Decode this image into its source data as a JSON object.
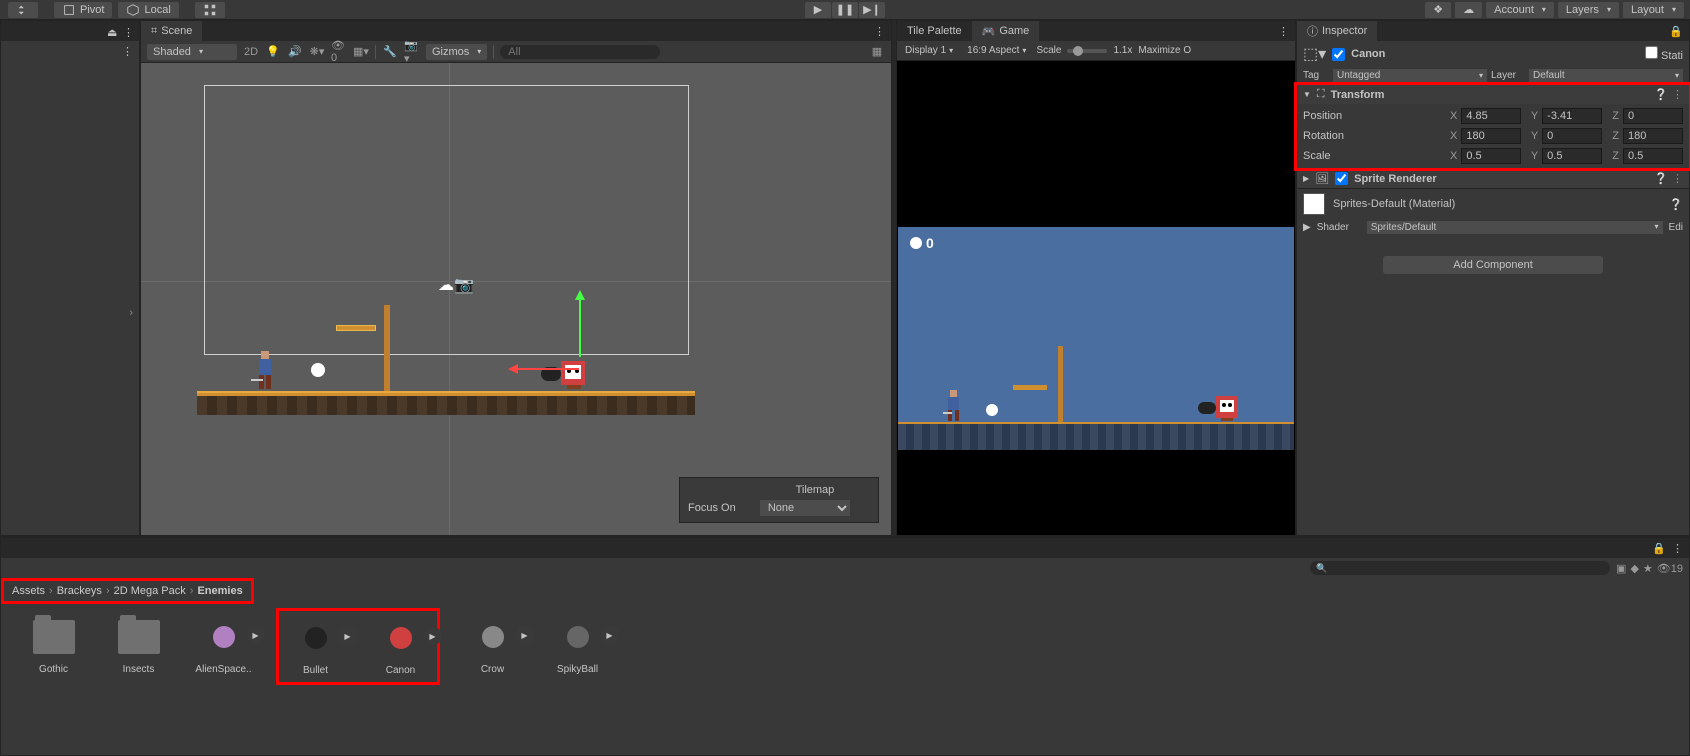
{
  "toolbar": {
    "pivot": "Pivot",
    "local": "Local",
    "account": "Account",
    "layers": "Layers",
    "layout": "Layout"
  },
  "scene": {
    "tab": "Scene",
    "shaded": "Shaded",
    "mode2d": "2D",
    "gizmos": "Gizmos",
    "search_ph": "All",
    "overlay_tilemap": "Tilemap",
    "overlay_focus": "Focus On",
    "overlay_none": "None"
  },
  "game": {
    "tab_palette": "Tile Palette",
    "tab_game": "Game",
    "display": "Display 1",
    "aspect": "16:9 Aspect",
    "scale_label": "Scale",
    "scale_val": "1.1x",
    "maximize": "Maximize O",
    "score": "0"
  },
  "inspector": {
    "tab": "Inspector",
    "obj_name": "Canon",
    "static": "Stati",
    "tag_label": "Tag",
    "tag_val": "Untagged",
    "layer_label": "Layer",
    "layer_val": "Default",
    "transform": {
      "title": "Transform",
      "position": "Position",
      "rotation": "Rotation",
      "scale": "Scale",
      "pos": {
        "x": "4.85",
        "y": "-3.41",
        "z": "0"
      },
      "rot": {
        "x": "180",
        "y": "0",
        "z": "180"
      },
      "scl": {
        "x": "0.5",
        "y": "0.5",
        "z": "0.5"
      }
    },
    "sprite_renderer": "Sprite Renderer",
    "material": "Sprites-Default (Material)",
    "shader_label": "Shader",
    "shader_val": "Sprites/Default",
    "edit": "Edi",
    "add_component": "Add Component"
  },
  "project": {
    "hidden_count": "19",
    "breadcrumb": [
      "Assets",
      "Brackeys",
      "2D Mega Pack",
      "Enemies"
    ],
    "assets": [
      {
        "label": "Gothic",
        "type": "folder"
      },
      {
        "label": "Insects",
        "type": "folder"
      },
      {
        "label": "AlienSpace..",
        "type": "sprite",
        "color": "#b080c0"
      },
      {
        "label": "Bullet",
        "type": "sprite",
        "color": "#222"
      },
      {
        "label": "Canon",
        "type": "sprite",
        "color": "#d04040"
      },
      {
        "label": "Crow",
        "type": "sprite",
        "color": "#888"
      },
      {
        "label": "SpikyBall",
        "type": "sprite",
        "color": "#666"
      }
    ]
  }
}
